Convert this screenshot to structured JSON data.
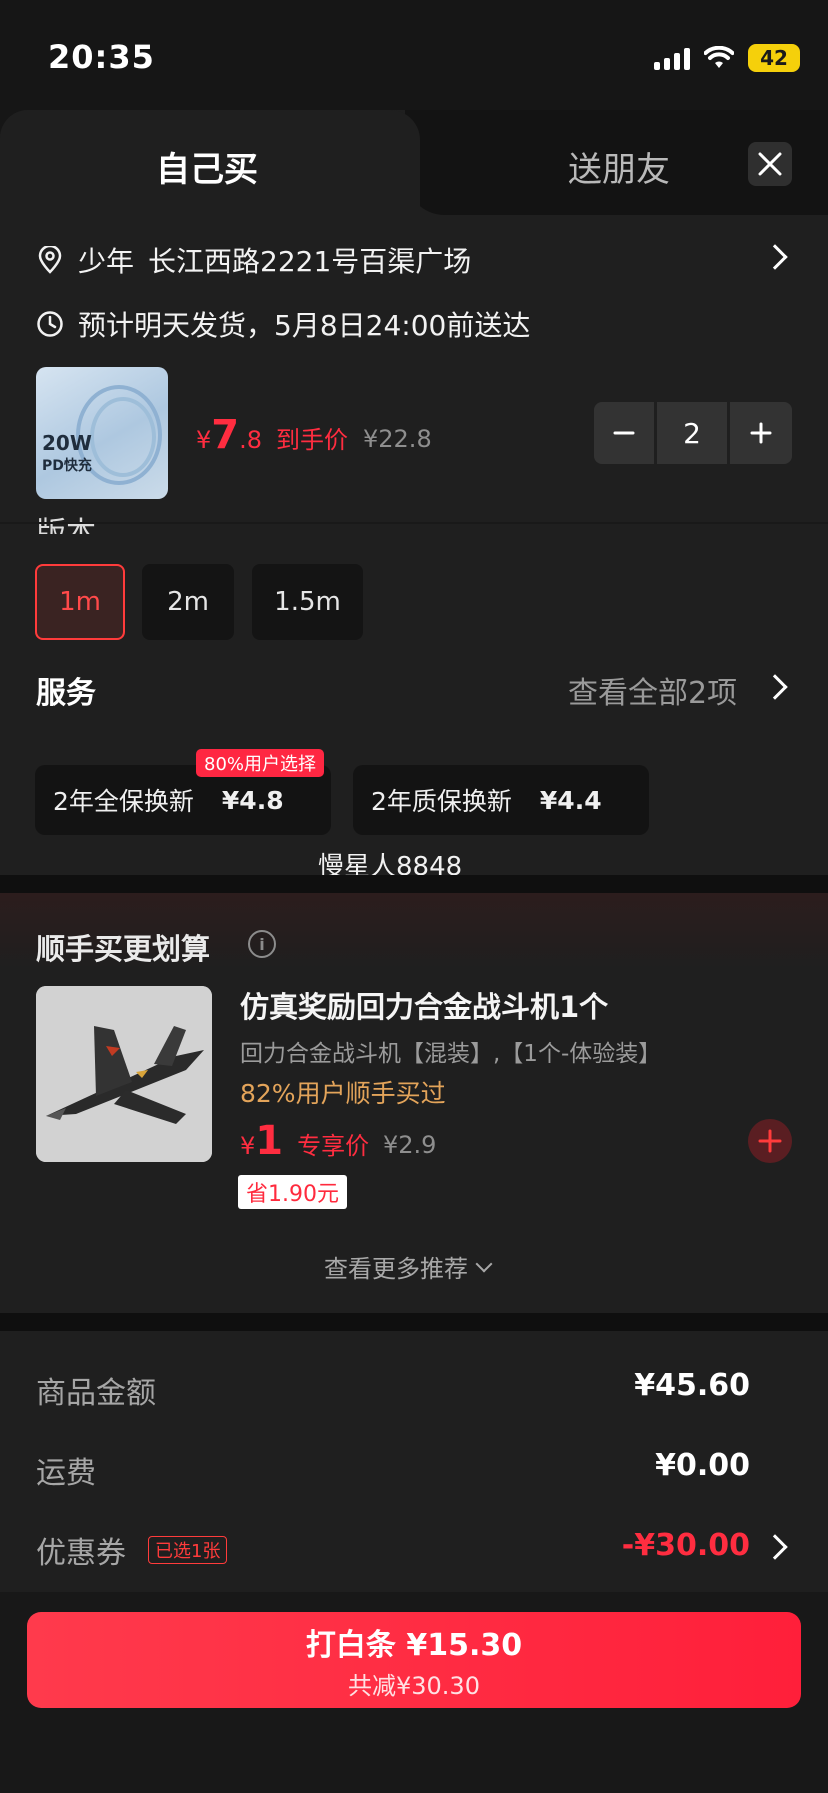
{
  "status": {
    "time": "20:35",
    "battery": "42"
  },
  "tabs": {
    "self": "自己买",
    "friend": "送朋友"
  },
  "address": {
    "name": "少年",
    "detail": "长江西路2221号百渠广场"
  },
  "delivery": {
    "text": "预计明天发货，5月8日24:00前送达"
  },
  "product": {
    "thumb_badge": "20W",
    "thumb_sub": "PD快充",
    "price_symbol": "¥",
    "price_int": "7",
    "price_dec": ".8",
    "price_tag": "到手价",
    "original_price": "¥22.8",
    "quantity": "2"
  },
  "spec": {
    "title_partial": "版本",
    "options": [
      "1m",
      "2m",
      "1.5m"
    ],
    "selected": "1m"
  },
  "service": {
    "title": "服务",
    "view_all": "查看全部2项",
    "cards": [
      {
        "name": "2年全保换新",
        "price": "¥4.8"
      },
      {
        "name": "2年质保换新",
        "price": "¥4.4"
      }
    ],
    "badge": "80%用户选择"
  },
  "watermark": "慢星人8848",
  "recommend": {
    "title": "顺手买更划算",
    "item_name": "仿真奖励回力合金战斗机1个",
    "item_sub": "回力合金战斗机【混装】,【1个-体验装】",
    "popularity": "82%用户顺手买过",
    "price_symbol": "¥",
    "price_int": "1",
    "price_tag": "专享价",
    "original_price": "¥2.9",
    "save": "省1.90元",
    "more": "查看更多推荐"
  },
  "summary": {
    "goods_label": "商品金额",
    "goods_value": "¥45.60",
    "shipping_label": "运费",
    "shipping_value": "¥0.00",
    "coupon_label": "优惠券",
    "coupon_badge": "已选1张",
    "coupon_value": "-¥30.00"
  },
  "pay": {
    "main": "打白条 ¥15.30",
    "sub": "共减¥30.30"
  },
  "colors": {
    "accent": "#ff2d40",
    "background": "#1f1f1f",
    "gold": "#e3a45a"
  }
}
